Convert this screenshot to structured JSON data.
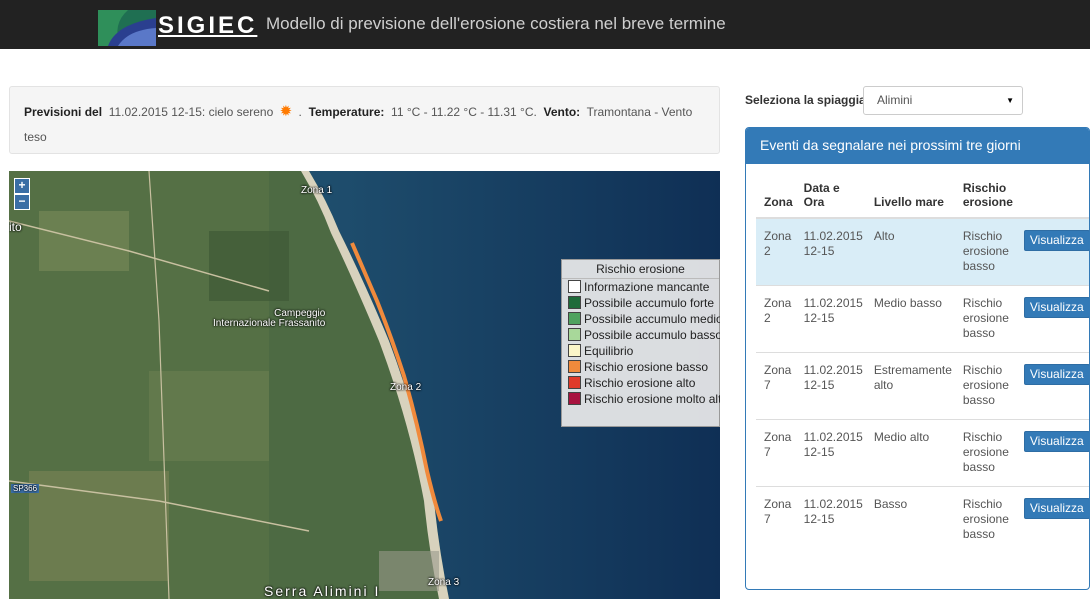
{
  "header": {
    "logo_text": "SIGIEC",
    "title": "Modello di previsione dell'erosione costiera nel breve termine"
  },
  "forecast": {
    "previsioni_label": "Previsioni del",
    "previsioni_value": "11.02.2015 12-15: cielo sereno",
    "weather_icon": "sun-icon",
    "sep": ".",
    "temperature_label": "Temperature:",
    "temperature_value": "11 °C - 11.22 °C - 11.31 °C.",
    "vento_label": "Vento:",
    "vento_value": "Tramontana - Vento teso"
  },
  "map": {
    "zoom_in": "+",
    "zoom_out": "−",
    "labels": {
      "zona1": "Zona 1",
      "zona2": "Zona 2",
      "zona3": "Zona 3",
      "campeggio": "Campeggio\nInternazionale Frassanito",
      "road": "SP366",
      "bottom_place": "Serra Alimini I",
      "left_edge": "ito"
    },
    "legend": {
      "title": "Rischio erosione",
      "items": [
        {
          "label": "Informazione mancante",
          "color": "#ffffff"
        },
        {
          "label": "Possibile accumulo forte",
          "color": "#1e6b3a"
        },
        {
          "label": "Possibile accumulo medio",
          "color": "#4fa35f"
        },
        {
          "label": "Possibile accumulo basso",
          "color": "#a8d89a"
        },
        {
          "label": "Equilibrio",
          "color": "#fbf6c8"
        },
        {
          "label": "Rischio erosione basso",
          "color": "#f08a3c"
        },
        {
          "label": "Rischio erosione alto",
          "color": "#e03a2a"
        },
        {
          "label": "Rischio erosione molto alto",
          "color": "#a8123f"
        }
      ]
    }
  },
  "beach_select": {
    "label": "Seleziona la spiaggia",
    "value": "Alimini"
  },
  "events": {
    "title": "Eventi da segnalare nei prossimi tre giorni",
    "columns": [
      "Zona",
      "Data e Ora",
      "Livello mare",
      "Rischio erosione"
    ],
    "button_label": "Visualizza",
    "rows": [
      {
        "zona": "Zona 2",
        "data": "11.02.2015 12-15",
        "livello": "Alto",
        "rischio": "Rischio erosione basso"
      },
      {
        "zona": "Zona 2",
        "data": "11.02.2015 12-15",
        "livello": "Medio basso",
        "rischio": "Rischio erosione basso"
      },
      {
        "zona": "Zona 7",
        "data": "11.02.2015 12-15",
        "livello": "Estremamente alto",
        "rischio": "Rischio erosione basso"
      },
      {
        "zona": "Zona 7",
        "data": "11.02.2015 12-15",
        "livello": "Medio alto",
        "rischio": "Rischio erosione basso"
      },
      {
        "zona": "Zona 7",
        "data": "11.02.2015 12-15",
        "livello": "Basso",
        "rischio": "Rischio erosione basso"
      }
    ]
  }
}
